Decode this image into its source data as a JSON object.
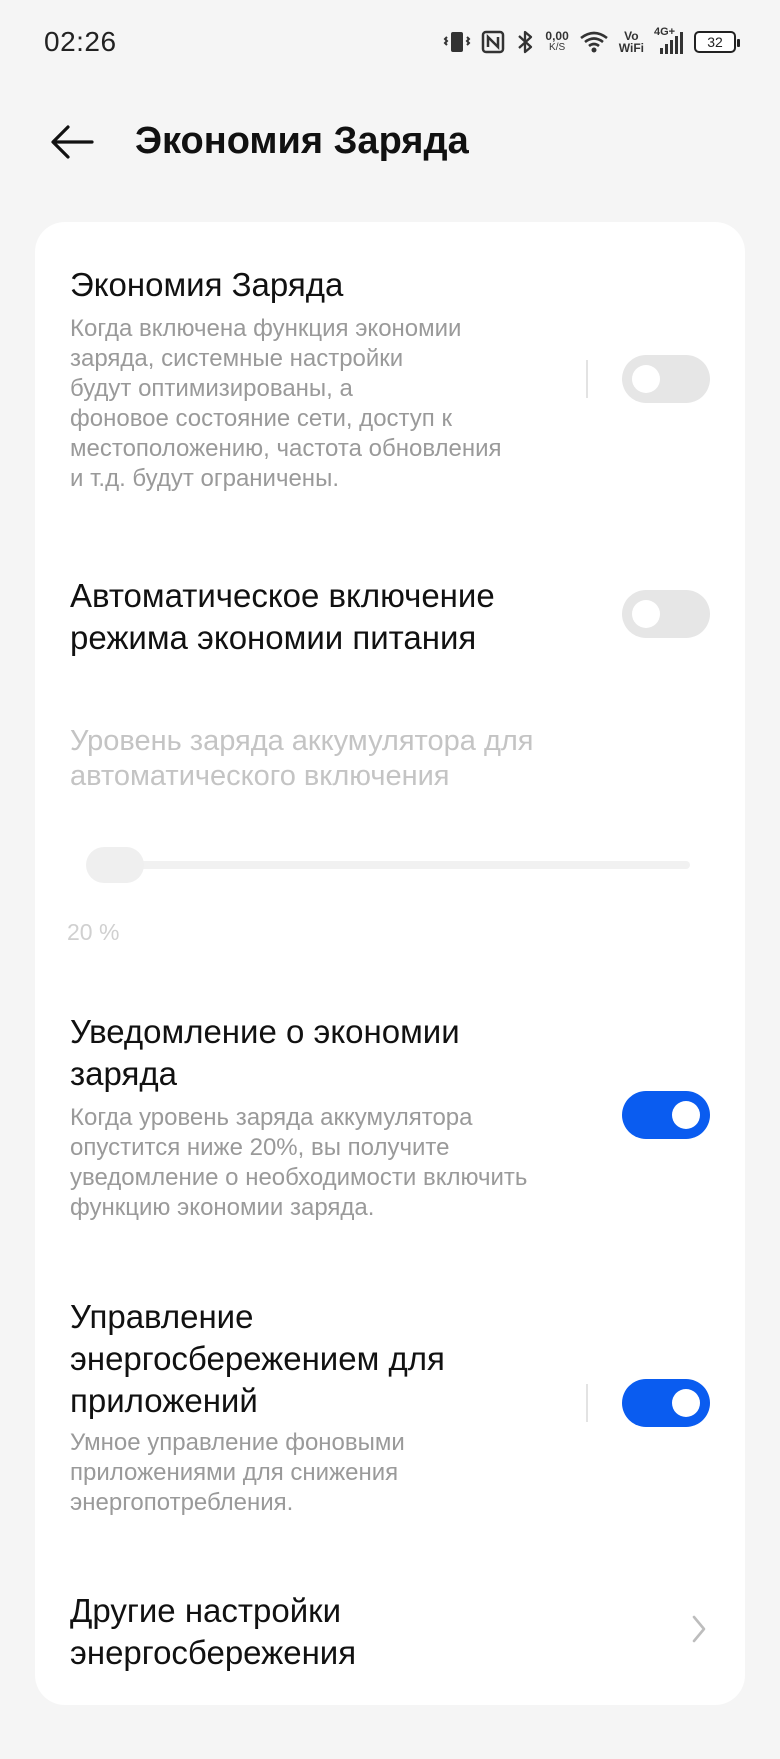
{
  "status_bar": {
    "time": "02:26",
    "net_speed_value": "0,00",
    "net_speed_unit": "K/S",
    "vowifi_top": "Vo",
    "vowifi_bottom": "WiFi",
    "network_type": "4G+",
    "battery_level": "32",
    "icons": [
      "vibrate-icon",
      "nfc-icon",
      "bluetooth-icon",
      "wifi-icon",
      "signal-icon",
      "battery-icon"
    ]
  },
  "header": {
    "title": "Экономия Заряда",
    "back_icon": "arrow-left-icon"
  },
  "settings": {
    "saver": {
      "title": "Экономия Заряда",
      "desc_lines": [
        "Когда включена функция экономии",
        "заряда, системные настройки",
        "будут оптимизированы, а",
        "фоновое состояние сети, доступ к",
        "местоположению, частота обновления",
        "и т.д. будут ограничены."
      ],
      "enabled": false
    },
    "auto_enable": {
      "title_lines": [
        "Автоматическое включение",
        "режима экономии питания"
      ],
      "enabled": false
    },
    "auto_level": {
      "label_lines": [
        "Уровень заряда аккумулятора для",
        "автоматического включения"
      ],
      "value": "20 %",
      "level_fraction": 0.0
    },
    "notify": {
      "title_lines": [
        "Уведомление о экономии",
        "заряда"
      ],
      "desc_lines": [
        "Когда уровень заряда аккумулятора",
        "опустится ниже 20%, вы получите",
        "уведомление о необходимости включить",
        "функцию экономии заряда."
      ],
      "enabled": true
    },
    "app_power": {
      "title_lines": [
        "Управление",
        "энергосбережением для",
        "приложений"
      ],
      "desc_lines": [
        "Умное управление фоновыми",
        "приложениями для снижения",
        "энергопотребления."
      ],
      "enabled": true
    },
    "other": {
      "title_lines": [
        "Другие настройки",
        "энергосбережения"
      ],
      "chevron_icon": "chevron-right-icon"
    }
  },
  "colors": {
    "accent": "#0a5cf0",
    "toggle_off": "#e6e6e6",
    "background": "#f5f5f5",
    "card": "#ffffff"
  }
}
